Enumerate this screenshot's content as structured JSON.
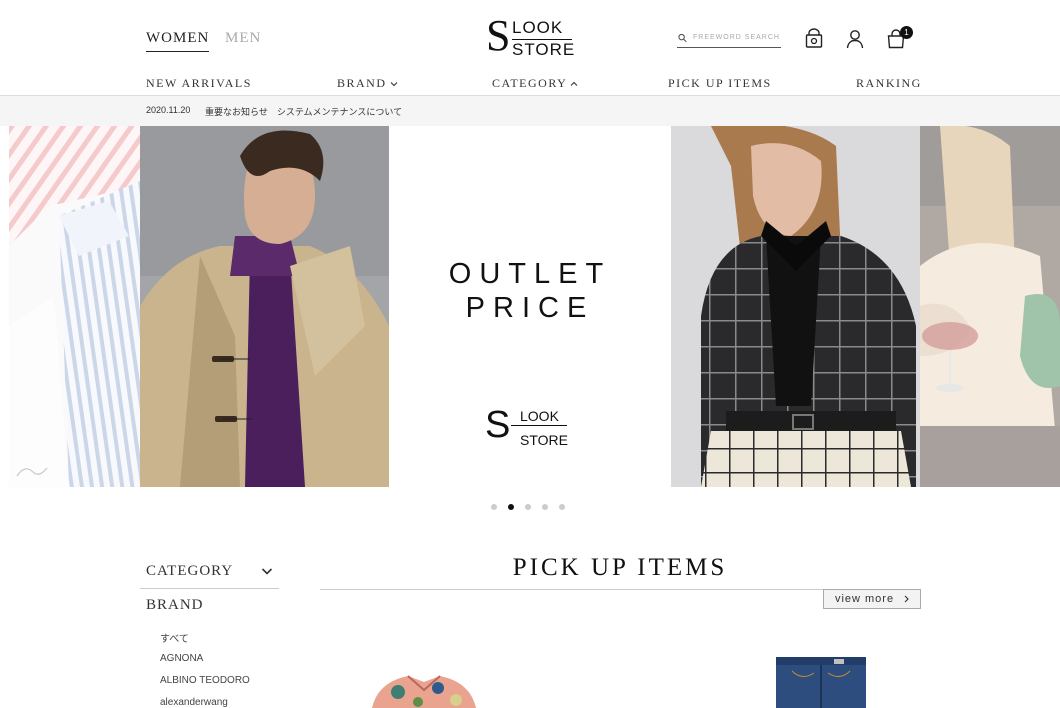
{
  "header": {
    "gender_tabs": [
      "WOMEN",
      "MEN"
    ],
    "active_gender": "WOMEN",
    "logo": {
      "initial": "S",
      "line1": "LOOK",
      "line2": "STORE"
    },
    "search_placeholder": "FREEWORD SEARCH",
    "cart_count": "1"
  },
  "nav": {
    "items": [
      "NEW ARRIVALS",
      "BRAND",
      "CATEGORY",
      "PICK UP ITEMS",
      "RANKING"
    ]
  },
  "notice": {
    "date": "2020.11.20",
    "text": "重要なお知らせ　システムメンテナンスについて"
  },
  "carousel": {
    "banner_line1": "OUTLET",
    "banner_line2": "PRICE",
    "logo": {
      "initial": "S",
      "line1": "LOOK",
      "line2": "STORE"
    },
    "slide_count": 5,
    "active_slide": 2
  },
  "sidebar": {
    "category_label": "CATEGORY",
    "brand_label": "BRAND",
    "brands": [
      "すべて",
      "AGNONA",
      "ALBINO TEODORO",
      "alexanderwang"
    ]
  },
  "pickup": {
    "title": "PICK UP ITEMS",
    "view_more": "view more"
  },
  "colors": {
    "text": "#222222",
    "inactive": "#aaaaaa",
    "notice_bg": "#f5f5f5",
    "button_bg": "#f3f3f3",
    "dot_active": "#111111",
    "dot_inactive": "#cccccc"
  },
  "icons": {
    "search": "search-icon",
    "bag": "bag-icon",
    "user": "user-icon",
    "cart": "cart-icon",
    "chevron_down": "chevron-down-icon",
    "chevron_up": "chevron-up-icon",
    "chevron_right": "chevron-right-icon"
  }
}
